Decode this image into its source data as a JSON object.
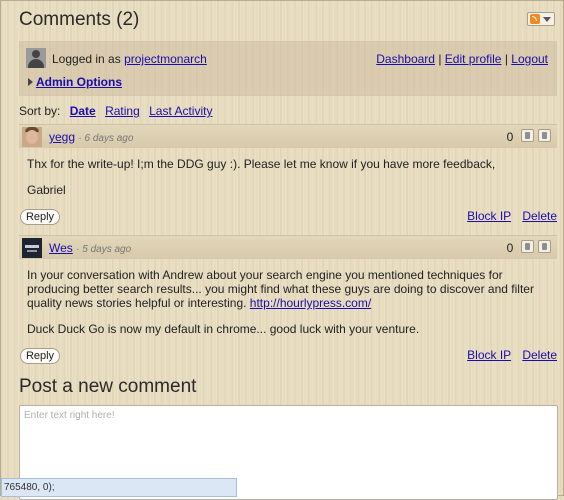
{
  "header": {
    "title": "Comments (2)"
  },
  "rss": {
    "icon": "rss-feed-icon"
  },
  "user": {
    "logged_prefix": "Logged in as",
    "username": "projectmonarch",
    "links": [
      "Dashboard",
      "Edit profile",
      "Logout"
    ],
    "separator": "|",
    "admin_options": "Admin Options"
  },
  "sort": {
    "label": "Sort by:",
    "options": [
      "Date",
      "Rating",
      "Last Activity"
    ],
    "active": "Date"
  },
  "comments": [
    {
      "author": "yegg",
      "time": "· 6 days ago",
      "votes": "0",
      "paragraphs": [
        "Thx for the write-up! I;m the DDG guy :). Please let me know if you have more feedback,",
        "Gabriel"
      ],
      "link": "",
      "reply_label": "Reply",
      "block_label": "Block IP",
      "delete_label": "Delete"
    },
    {
      "author": "Wes",
      "time": "· 5 days ago",
      "votes": "0",
      "paragraphs": [
        "In your conversation with Andrew about your search engine you mentioned techniques for producing better search results... you might find what these guys are doing to discover and filter quality news stories helpful or interesting.",
        "Duck Duck Go is now my default in chrome... good luck with your venture."
      ],
      "link": "http://hourlypress.com/",
      "reply_label": "Reply",
      "block_label": "Block IP",
      "delete_label": "Delete"
    }
  ],
  "post": {
    "heading": "Post a new comment",
    "placeholder": "Enter text right here!"
  },
  "status_bar": {
    "text": "765480, 0);"
  }
}
